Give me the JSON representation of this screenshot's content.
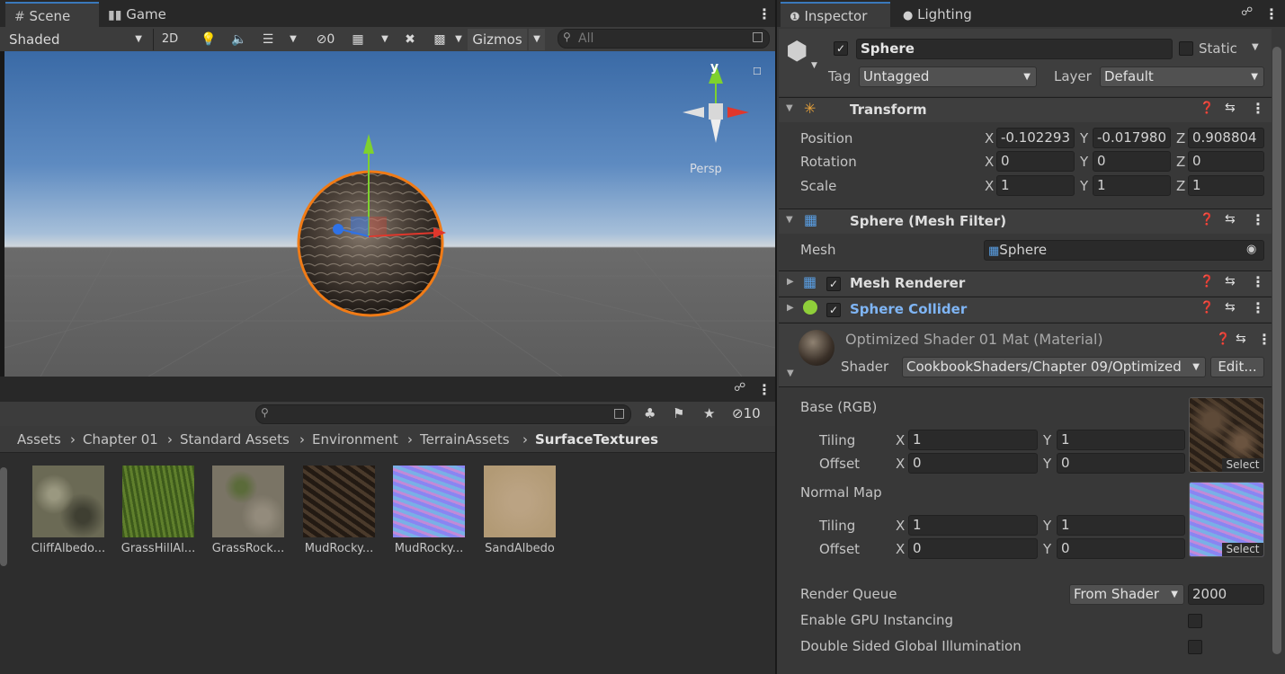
{
  "scene_tabs": {
    "scene": "Scene",
    "game": "Game"
  },
  "scene_toolbar": {
    "shading_mode": "Shaded",
    "mode_2d": "2D",
    "hidden_count": "0",
    "gizmos": "Gizmos",
    "search_placeholder": "All"
  },
  "viewport": {
    "axis_y_label": "y",
    "persp_label": "Persp",
    "selected_object": "Sphere"
  },
  "project": {
    "search_placeholder": "",
    "hidden_count": "10",
    "breadcrumb": [
      "Assets",
      "Chapter 01",
      "Standard Assets",
      "Environment",
      "TerrainAssets",
      "SurfaceTextures"
    ],
    "assets": [
      {
        "name": "CliffAlbedo...",
        "color": "#6b6a55"
      },
      {
        "name": "GrassHillAl...",
        "color": "#4f6b26"
      },
      {
        "name": "GrassRock...",
        "color": "#7a7465"
      },
      {
        "name": "MudRocky...",
        "color": "#3a3026"
      },
      {
        "name": "MudRocky...",
        "color": "#7e7fe0"
      },
      {
        "name": "SandAlbedo",
        "color": "#b29a75"
      }
    ]
  },
  "inspector_tabs": {
    "inspector": "Inspector",
    "lighting": "Lighting"
  },
  "object": {
    "name": "Sphere",
    "static_label": "Static",
    "tag_label": "Tag",
    "tag_value": "Untagged",
    "layer_label": "Layer",
    "layer_value": "Default"
  },
  "transform": {
    "title": "Transform",
    "position_label": "Position",
    "rotation_label": "Rotation",
    "scale_label": "Scale",
    "position": {
      "x": "-0.102293",
      "y": "-0.017980",
      "z": "0.908804"
    },
    "rotation": {
      "x": "0",
      "y": "0",
      "z": "0"
    },
    "scale": {
      "x": "1",
      "y": "1",
      "z": "1"
    }
  },
  "mesh_filter": {
    "title": "Sphere (Mesh Filter)",
    "mesh_label": "Mesh",
    "mesh_value": "Sphere"
  },
  "mesh_renderer": {
    "title": "Mesh Renderer"
  },
  "sphere_collider": {
    "title": "Sphere Collider"
  },
  "material": {
    "title": "Optimized Shader 01 Mat (Material)",
    "shader_label": "Shader",
    "shader_value": "CookbookShaders/Chapter 09/Optimized",
    "edit_label": "Edit...",
    "base_label": "Base (RGB)",
    "normal_label": "Normal Map",
    "tiling_label": "Tiling",
    "offset_label": "Offset",
    "select_label": "Select",
    "base_tiling": {
      "x": "1",
      "y": "1"
    },
    "base_offset": {
      "x": "0",
      "y": "0"
    },
    "normal_tiling": {
      "x": "1",
      "y": "1"
    },
    "normal_offset": {
      "x": "0",
      "y": "0"
    },
    "render_queue_label": "Render Queue",
    "render_queue_mode": "From Shader",
    "render_queue_value": "2000",
    "gpu_instancing_label": "Enable GPU Instancing",
    "double_sided_label": "Double Sided Global Illumination"
  },
  "colors": {
    "accent_blue": "#3a79bb",
    "selection_orange": "#f07b16",
    "collider_title": "#7fb5f5"
  }
}
